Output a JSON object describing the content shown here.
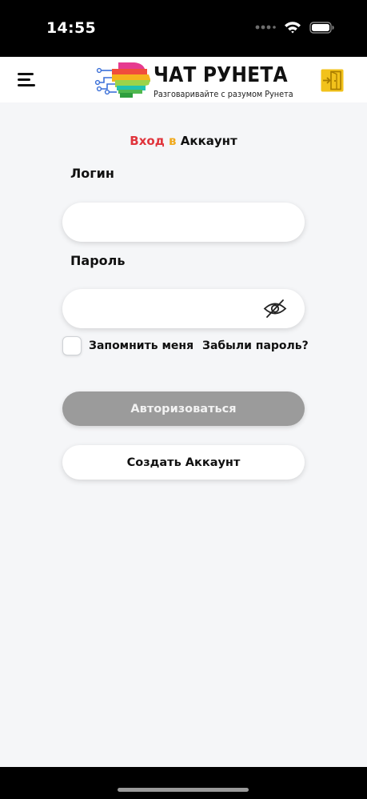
{
  "status_bar": {
    "time": "14:55",
    "icons": [
      "signal-dots-icon",
      "wifi-icon",
      "battery-icon"
    ]
  },
  "header": {
    "menu_icon": "hamburger-menu-icon",
    "logo": {
      "title": "ЧАТ РУНЕТА",
      "subtitle": "Разговаривайте с разумом Рунета"
    },
    "login_icon": "door-login-icon"
  },
  "form": {
    "title": {
      "part1": "Вход",
      "part2": "в",
      "part3": "Аккаунт"
    },
    "login_label": "Логин",
    "login_value": "",
    "password_label": "Пароль",
    "password_value": "",
    "password_toggle_icon": "eye-slash-icon",
    "remember_label": "Запомнить меня",
    "remember_checked": false,
    "forgot_link": "Забыли пароль?",
    "authorize_button": "Авторизоваться",
    "create_account_button": "Создать Аккаунт"
  },
  "colors": {
    "title_red": "#e0343c",
    "title_yellow": "#f0a91d",
    "authorize_button_bg": "#9b9b9b",
    "page_bg": "#f5f6f8",
    "door_icon": "#f2c21b"
  }
}
